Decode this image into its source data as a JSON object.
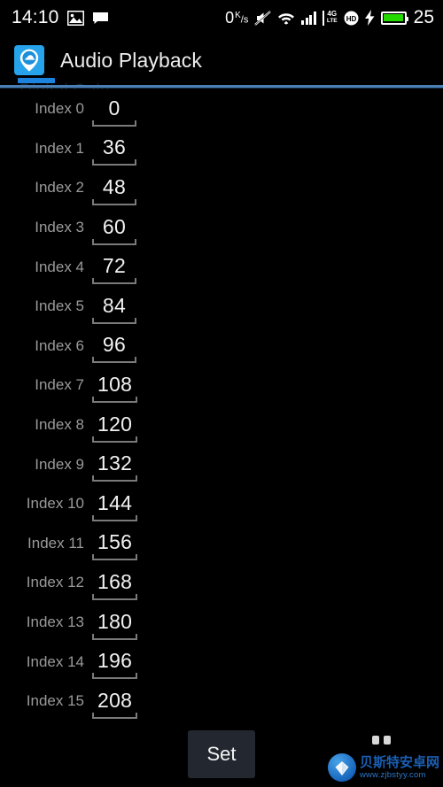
{
  "status_bar": {
    "clock": "14:10",
    "left_icons": [
      "image-icon",
      "message-icon"
    ],
    "net_rate_value": "0",
    "net_rate_unit_top": "K",
    "net_rate_unit_bottom": "s",
    "right_icons": [
      "mute-icon",
      "wifi-icon",
      "signal-bars-icon",
      "4g-lte-icon",
      "hd-icon",
      "charging-bolt-icon",
      "battery-icon"
    ],
    "lte_top": "4G",
    "lte_bottom": "LTE",
    "hd_label": "HD",
    "battery_percent": "25"
  },
  "action_bar": {
    "app_icon": "cloud-pin-icon",
    "title": "Audio Playback"
  },
  "section": {
    "ghost_header": "Digital Gain"
  },
  "list": {
    "rows": [
      {
        "label": "Index 0",
        "value": "0"
      },
      {
        "label": "Index 1",
        "value": "36"
      },
      {
        "label": "Index 2",
        "value": "48"
      },
      {
        "label": "Index 3",
        "value": "60"
      },
      {
        "label": "Index 4",
        "value": "72"
      },
      {
        "label": "Index 5",
        "value": "84"
      },
      {
        "label": "Index 6",
        "value": "96"
      },
      {
        "label": "Index 7",
        "value": "108"
      },
      {
        "label": "Index 8",
        "value": "120"
      },
      {
        "label": "Index 9",
        "value": "132"
      },
      {
        "label": "Index 10",
        "value": "144"
      },
      {
        "label": "Index 11",
        "value": "156"
      },
      {
        "label": "Index 12",
        "value": "168"
      },
      {
        "label": "Index 13",
        "value": "180"
      },
      {
        "label": "Index 14",
        "value": "196"
      },
      {
        "label": "Index 15",
        "value": "208"
      }
    ]
  },
  "bottom_bar": {
    "set_label": "Set"
  },
  "watermark": {
    "site_name": "贝斯特安卓网",
    "url": "www.zjbstyy.com"
  },
  "colors": {
    "background": "#000000",
    "accent_blue": "#1b82dd",
    "divider_blue": "#4a7fb5",
    "app_icon_blue": "#27a3eb",
    "battery_green": "#24d900",
    "label_gray": "#9a9a9a",
    "value_white": "#f2f2f2",
    "underline_gray": "#7a7a7a",
    "button_gray": "#232830"
  }
}
